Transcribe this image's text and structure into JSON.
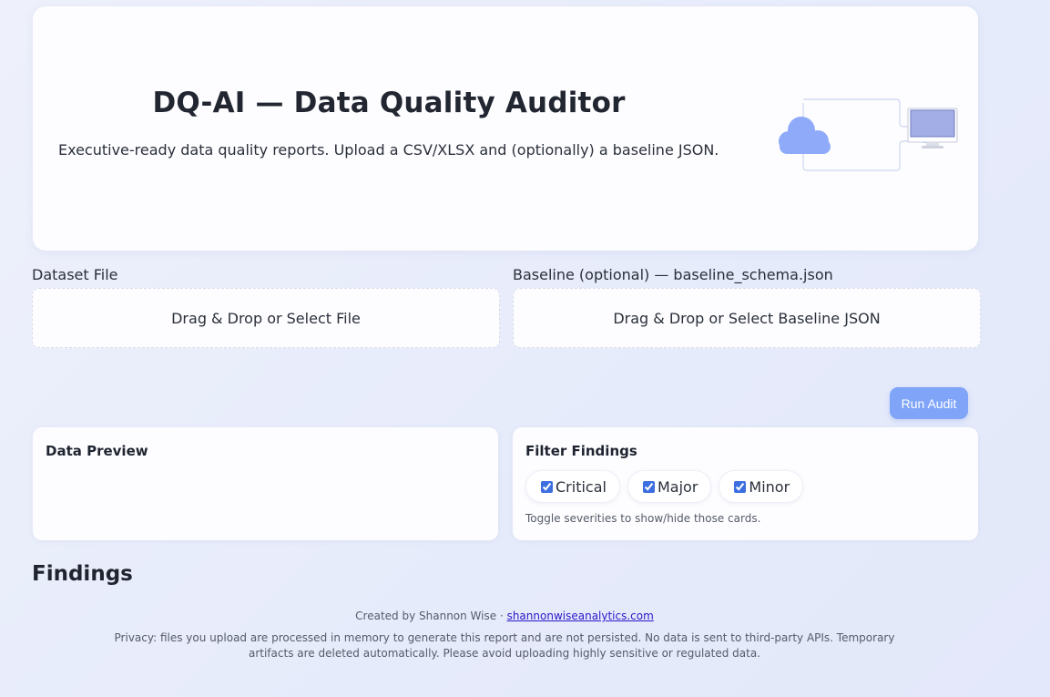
{
  "hero": {
    "title": "DQ-AI — Data Quality Auditor",
    "subtitle": "Executive-ready data quality reports. Upload a CSV/XLSX and (optionally) a baseline JSON.",
    "illustration_icons": [
      "cloud-icon",
      "monitor-icon"
    ]
  },
  "uploads": {
    "dataset": {
      "label": "Dataset File",
      "dropzone_text": "Drag & Drop or Select File"
    },
    "baseline": {
      "label": "Baseline (optional) — baseline_schema.json",
      "dropzone_text": "Drag & Drop or Select Baseline JSON"
    }
  },
  "run_button_label": "Run Audit",
  "preview": {
    "title": "Data Preview"
  },
  "filter": {
    "title": "Filter Findings",
    "options": [
      {
        "label": "Critical",
        "checked": true
      },
      {
        "label": "Major",
        "checked": true
      },
      {
        "label": "Minor",
        "checked": true
      }
    ],
    "hint": "Toggle severities to show/hide those cards."
  },
  "findings_heading": "Findings",
  "footer": {
    "credit_prefix": "Created by Shannon Wise · ",
    "link_text": "shannonwiseanalytics.com",
    "privacy": "Privacy: files you upload are processed in memory to generate this report and are not persisted. No data is sent to third-party APIs. Temporary artifacts are deleted automatically. Please avoid uploading highly sensitive or regulated data."
  },
  "colors": {
    "accent": "#7fa4f8",
    "cloud": "#8eaaf8",
    "monitor": "#a3aee6",
    "link": "#2a18c8"
  }
}
